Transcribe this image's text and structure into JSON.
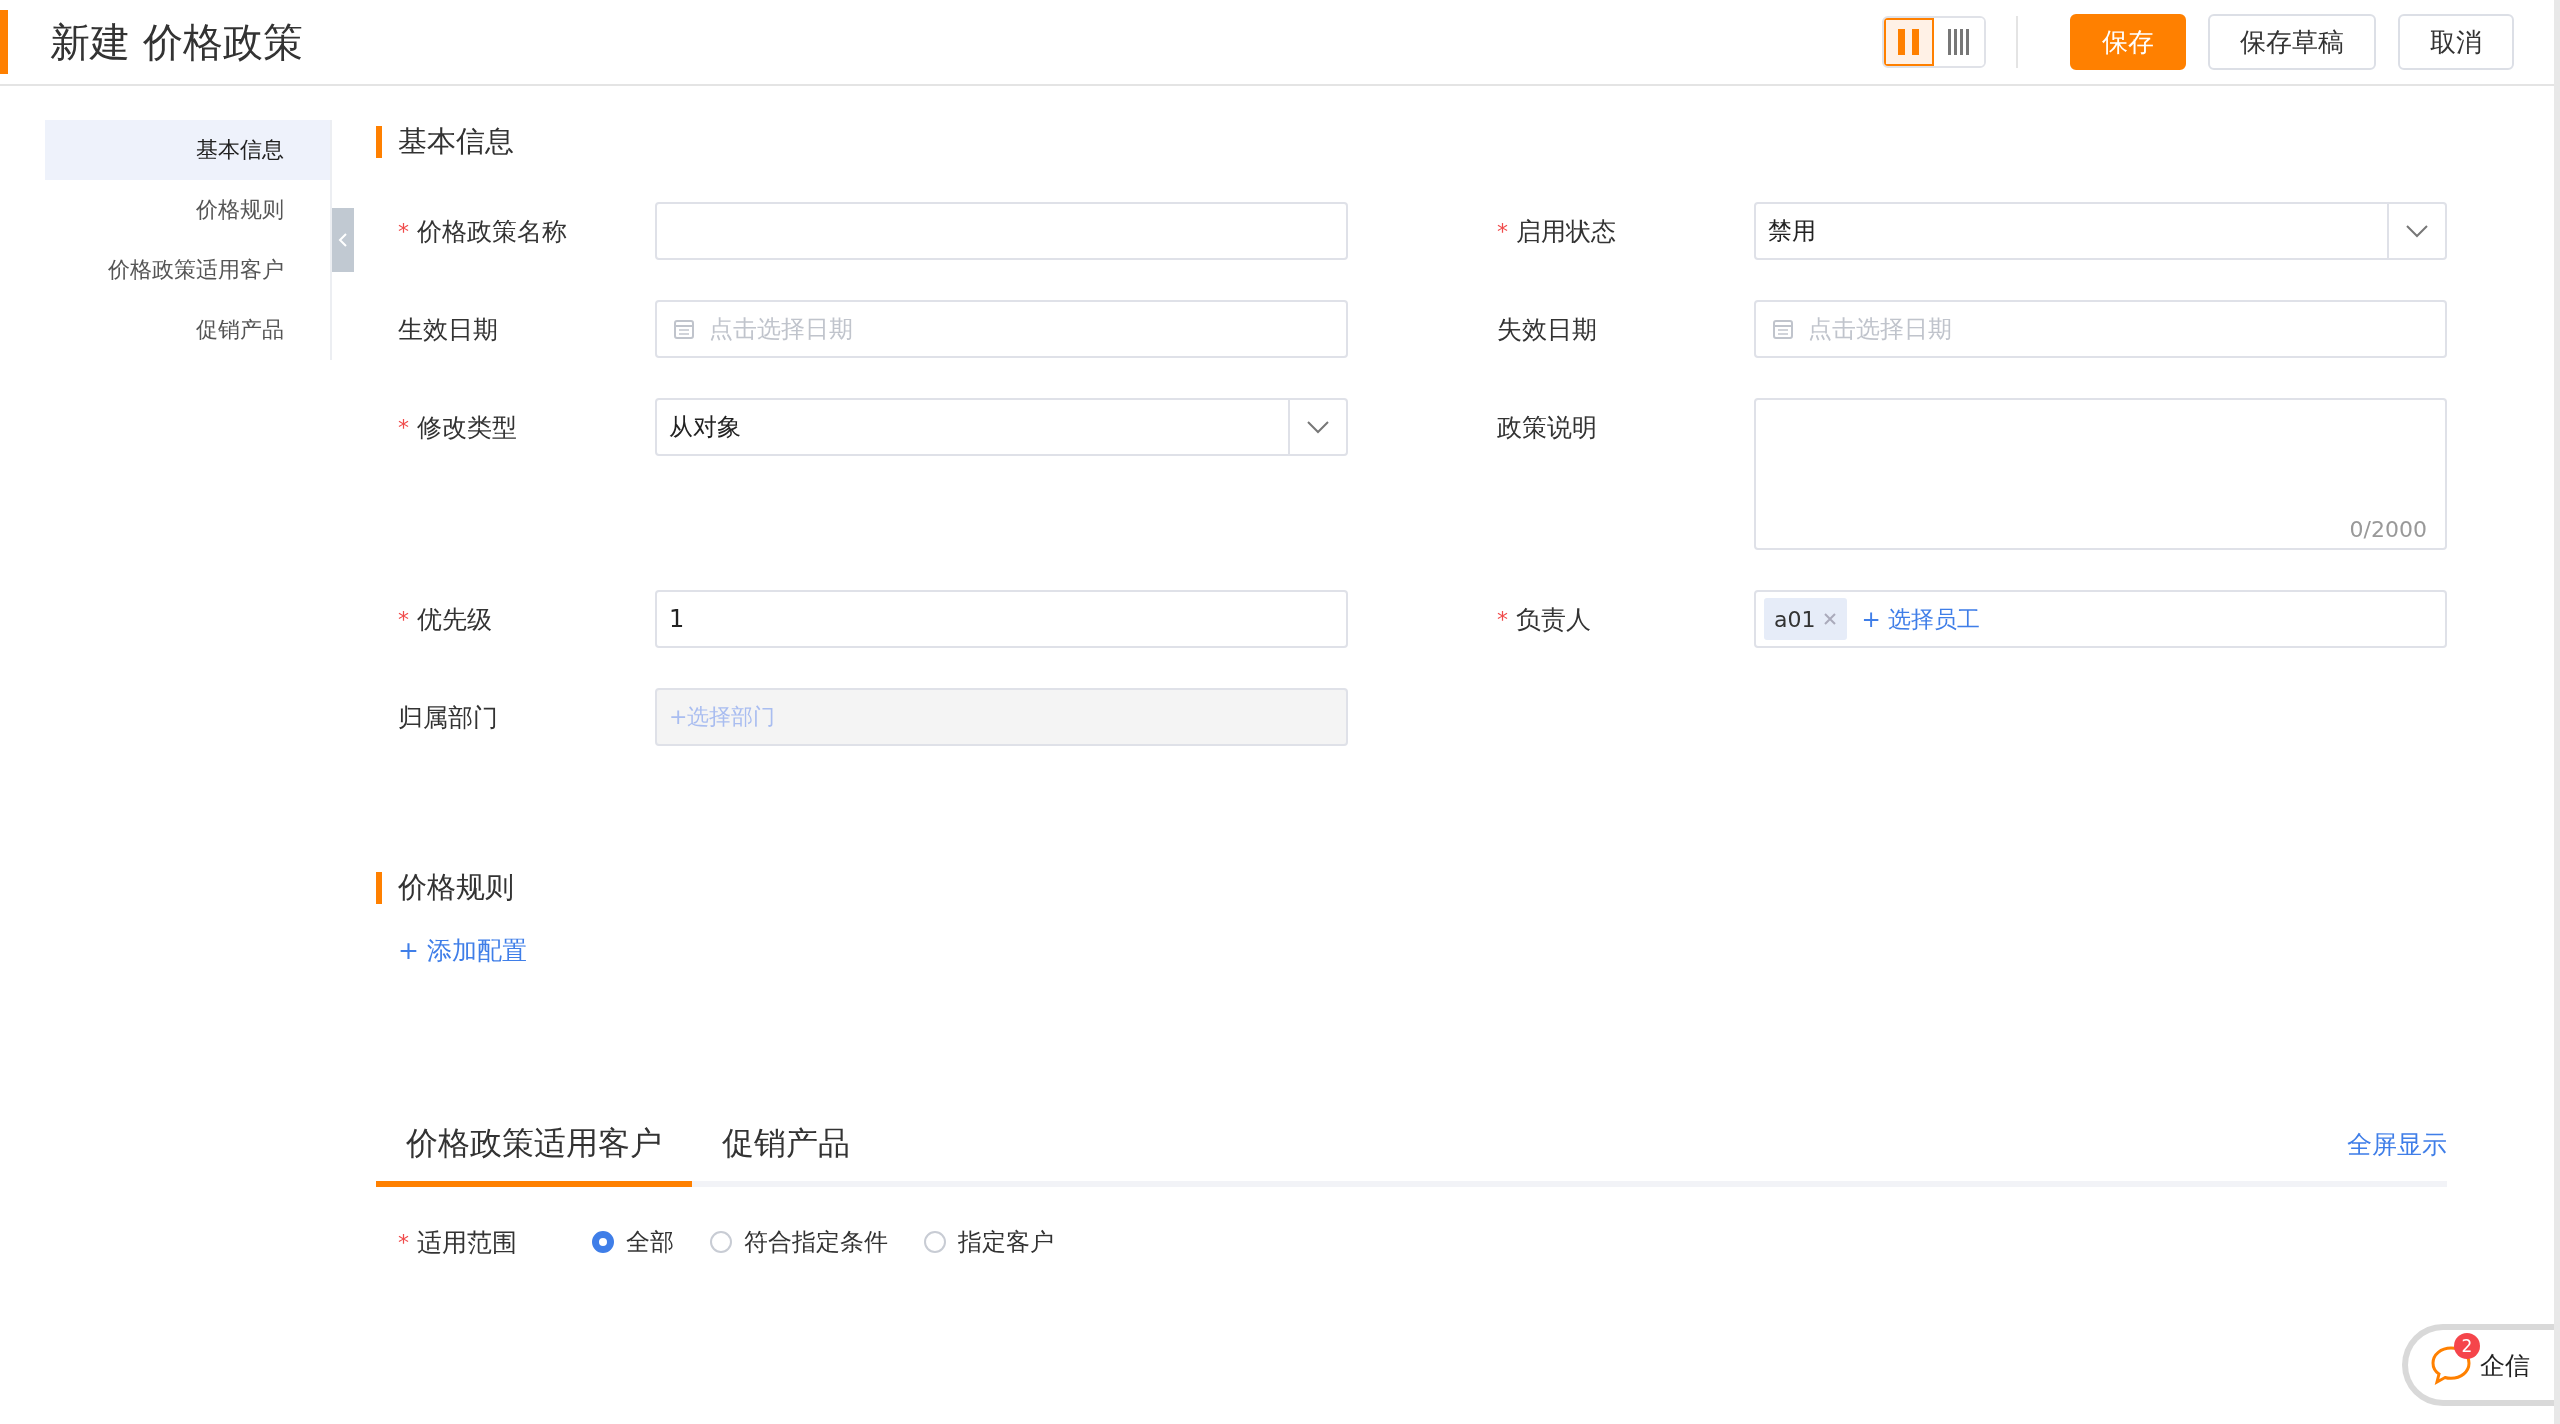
{
  "header": {
    "title": "新建 价格政策",
    "layout_toggle": [
      {
        "kind": "two-column",
        "selected": true
      },
      {
        "kind": "four-column",
        "selected": false
      }
    ],
    "buttons": [
      {
        "label": "保存",
        "kind": "primary"
      },
      {
        "label": "保存草稿",
        "kind": "default"
      },
      {
        "label": "取消",
        "kind": "default"
      }
    ]
  },
  "sidebar": {
    "items": [
      {
        "label": "基本信息",
        "selected": true
      },
      {
        "label": "价格规则",
        "selected": false
      },
      {
        "label": "价格政策适用客户",
        "selected": false
      },
      {
        "label": "促销产品",
        "selected": false
      }
    ]
  },
  "basic_info": {
    "title": "基本信息",
    "left_fields": [
      {
        "label": "价格政策名称",
        "required": true,
        "kind": "text"
      },
      {
        "label": "生效日期",
        "required": false,
        "kind": "date",
        "placeholder": "点击选择日期"
      },
      {
        "label": "修改类型",
        "required": true,
        "kind": "select",
        "value": "从对象"
      },
      {
        "label": "优先级",
        "required": true,
        "kind": "text",
        "value": "1"
      },
      {
        "label": "归属部门",
        "required": false,
        "kind": "picker",
        "placeholder": "+选择部门"
      }
    ],
    "right_fields": [
      {
        "label": "启用状态",
        "required": true,
        "kind": "select",
        "value": "禁用"
      },
      {
        "label": "失效日期",
        "required": false,
        "kind": "date",
        "placeholder": "点击选择日期"
      },
      {
        "label": "政策说明",
        "required": false,
        "kind": "textarea",
        "counter": "0/2000"
      },
      {
        "label": "负责人",
        "required": true,
        "kind": "tags",
        "tags": [
          "a01"
        ],
        "add_label": "+ 选择员工"
      }
    ]
  },
  "price_rules": {
    "title": "价格规则",
    "add_link": "+ 添加配置"
  },
  "tabs": [
    {
      "label": "价格政策适用客户",
      "selected": true
    },
    {
      "label": "促销产品",
      "selected": false
    }
  ],
  "fullscreen_link": "全屏显示",
  "scope": {
    "label": "适用范围",
    "required": true,
    "options": [
      {
        "label": "全部",
        "selected": true
      },
      {
        "label": "符合指定条件",
        "selected": false
      },
      {
        "label": "指定客户",
        "selected": false
      }
    ]
  },
  "chat_widget": {
    "label": "企信",
    "badge": "2"
  },
  "required_mark": "*"
}
